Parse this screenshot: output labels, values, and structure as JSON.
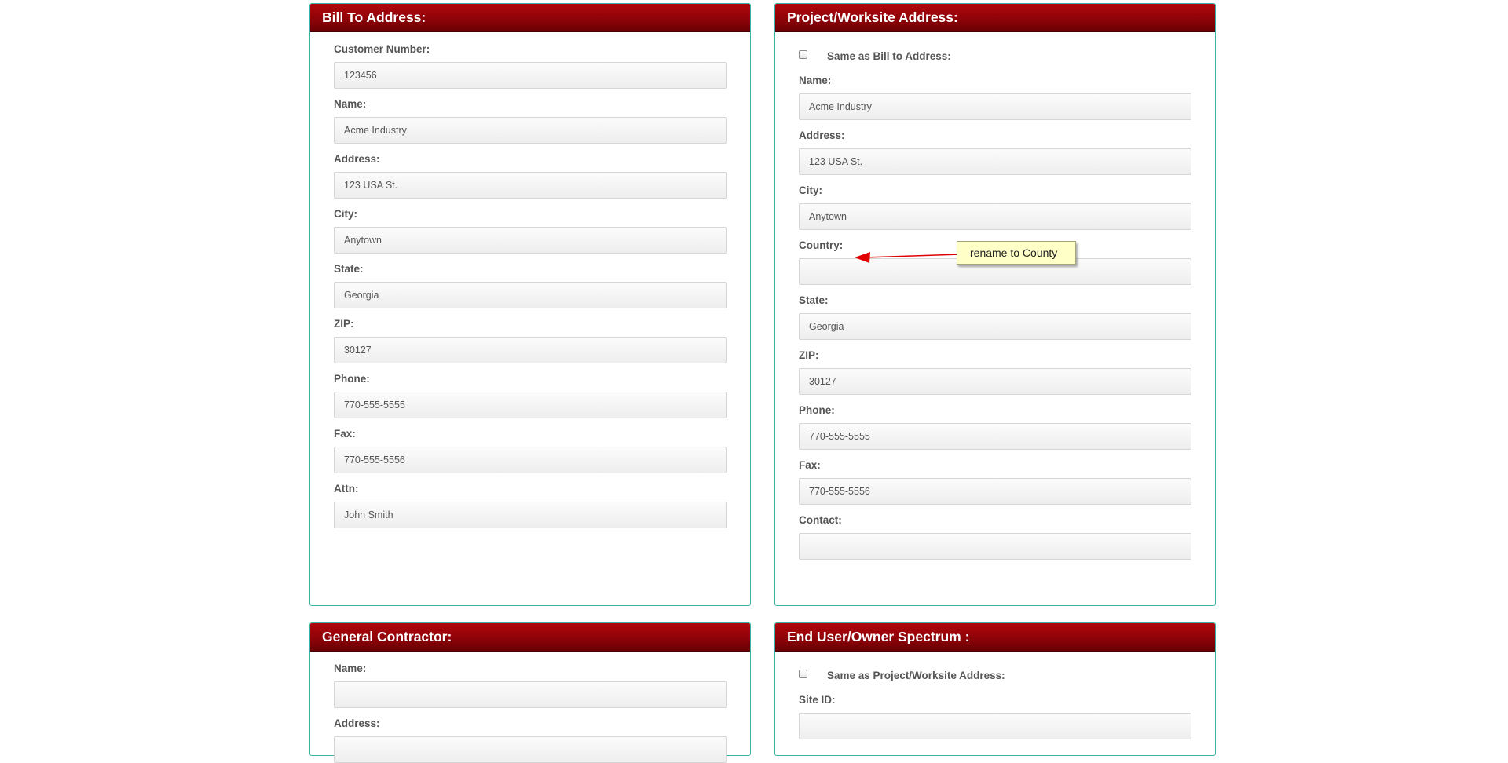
{
  "bill_to": {
    "title": "Bill To Address:",
    "fields": [
      {
        "label": "Customer Number:",
        "value": "123456"
      },
      {
        "label": "Name:",
        "value": "Acme Industry"
      },
      {
        "label": "Address:",
        "value": "123 USA St."
      },
      {
        "label": "City:",
        "value": "Anytown"
      },
      {
        "label": "State:",
        "value": "Georgia"
      },
      {
        "label": "ZIP:",
        "value": "30127"
      },
      {
        "label": "Phone:",
        "value": "770-555-5555"
      },
      {
        "label": "Fax:",
        "value": "770-555-5556"
      },
      {
        "label": "Attn:",
        "value": "John Smith"
      }
    ]
  },
  "project": {
    "title": "Project/Worksite Address:",
    "same_as_label": "Same as Bill to Address:",
    "fields": [
      {
        "label": "Name:",
        "value": "Acme Industry"
      },
      {
        "label": "Address:",
        "value": "123 USA St."
      },
      {
        "label": "City:",
        "value": "Anytown"
      },
      {
        "label": "Country:",
        "value": ""
      },
      {
        "label": "State:",
        "value": "Georgia"
      },
      {
        "label": "ZIP:",
        "value": "30127"
      },
      {
        "label": "Phone:",
        "value": "770-555-5555"
      },
      {
        "label": "Fax:",
        "value": "770-555-5556"
      },
      {
        "label": "Contact:",
        "value": ""
      }
    ]
  },
  "general_contractor": {
    "title": "General Contractor:",
    "fields": [
      {
        "label": "Name:",
        "value": ""
      },
      {
        "label": "Address:",
        "value": ""
      }
    ]
  },
  "end_user": {
    "title": "End User/Owner Spectrum :",
    "same_as_label": "Same as Project/Worksite Address:",
    "fields": [
      {
        "label": "Site ID:",
        "value": ""
      }
    ]
  },
  "annotation": {
    "text": "rename to County",
    "arrow_color": "#e00000"
  },
  "colors": {
    "header_red": "#8e0308",
    "panel_border": "#3bb3a8"
  }
}
